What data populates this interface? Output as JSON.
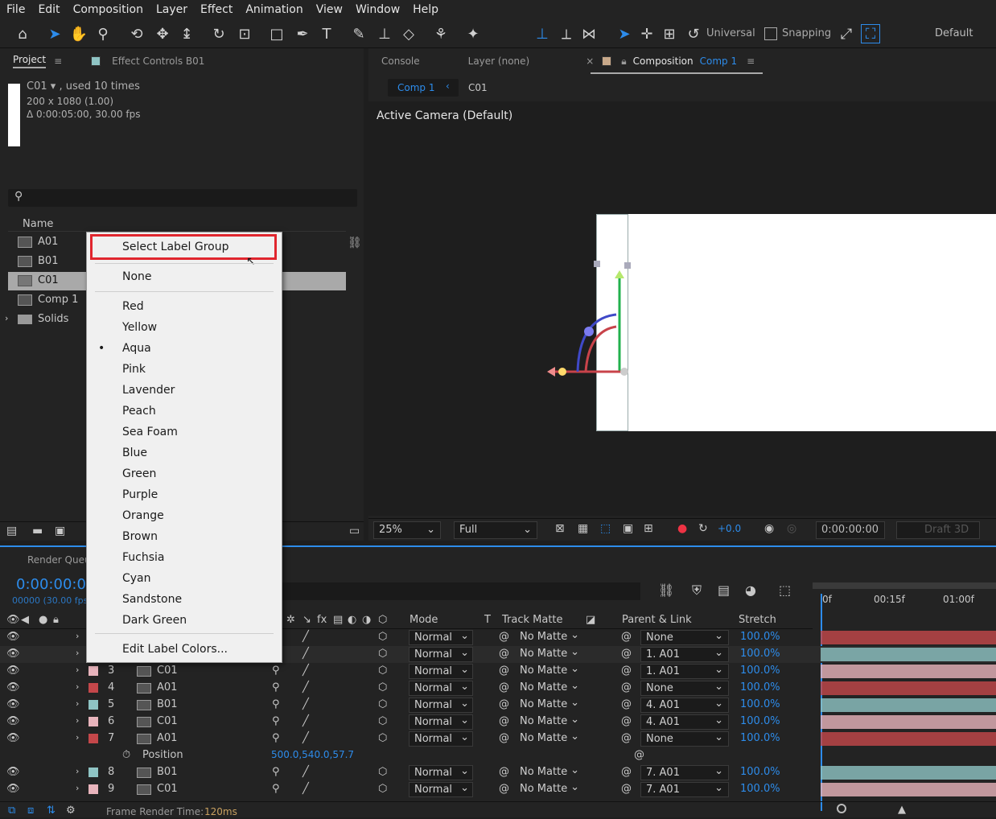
{
  "menu": [
    "File",
    "Edit",
    "Composition",
    "Layer",
    "Effect",
    "Animation",
    "View",
    "Window",
    "Help"
  ],
  "toolbar": {
    "universal_label": "Universal",
    "snapping_label": "Snapping",
    "workspace": "Default"
  },
  "project_panel": {
    "tab_project": "Project",
    "tab_effect_controls": "Effect Controls B01",
    "item_name": "C01",
    "item_used": ", used 10 times",
    "item_dims": "200 x 1080 (1.00)",
    "item_duration": "Δ 0:00:05:00, 30.00 fps",
    "search_placeholder": "",
    "name_header": "Name",
    "items": [
      {
        "name": "A01",
        "type": "footage"
      },
      {
        "name": "B01",
        "type": "footage"
      },
      {
        "name": "C01",
        "type": "footage",
        "selected": true
      },
      {
        "name": "Comp 1",
        "type": "comp"
      },
      {
        "name": "Solids",
        "type": "folder"
      }
    ]
  },
  "comp_panel": {
    "tab_console": "Console",
    "tab_layer": "Layer (none)",
    "tab_composition": "Composition",
    "tab_composition_name": "Comp 1",
    "breadcrumb_comp": "Comp 1",
    "breadcrumb_c01": "C01",
    "camera_label": "Active Camera (Default)",
    "zoom": "25%",
    "resolution": "Full",
    "exposure": "+0.0",
    "timecode": "0:00:00:00",
    "draft3d": "Draft 3D"
  },
  "context_menu": {
    "select_label_group": "Select Label Group",
    "none": "None",
    "colors": [
      "Red",
      "Yellow",
      "Aqua",
      "Pink",
      "Lavender",
      "Peach",
      "Sea Foam",
      "Blue",
      "Green",
      "Purple",
      "Orange",
      "Brown",
      "Fuchsia",
      "Cyan",
      "Sandstone",
      "Dark Green"
    ],
    "checked": "Aqua",
    "edit_label_colors": "Edit Label Colors..."
  },
  "timeline": {
    "tab_render_queue": "Render Queu",
    "timecode": "0:00:00:00",
    "frame_info": "00000 (30.00 fps",
    "headers": {
      "mode": "Mode",
      "t": "T",
      "track_matte": "Track Matte",
      "parent_link": "Parent & Link",
      "stretch": "Stretch"
    },
    "ruler": [
      "0f",
      "00:15f",
      "01:00f"
    ],
    "layers": [
      {
        "num": "",
        "name": "",
        "label": "#c4474a",
        "mode": "Normal",
        "matte": "No Matte",
        "parent": "None",
        "stretch": "100.0%"
      },
      {
        "num": "",
        "name": "",
        "label": "#8fc4c4",
        "mode": "Normal",
        "matte": "No Matte",
        "parent": "1. A01",
        "stretch": "100.0%"
      },
      {
        "num": "3",
        "name": "C01",
        "label": "#e8b4bc",
        "mode": "Normal",
        "matte": "No Matte",
        "parent": "1. A01",
        "stretch": "100.0%"
      },
      {
        "num": "4",
        "name": "A01",
        "label": "#c4474a",
        "mode": "Normal",
        "matte": "No Matte",
        "parent": "None",
        "stretch": "100.0%"
      },
      {
        "num": "5",
        "name": "B01",
        "label": "#8fc4c4",
        "mode": "Normal",
        "matte": "No Matte",
        "parent": "4. A01",
        "stretch": "100.0%"
      },
      {
        "num": "6",
        "name": "C01",
        "label": "#e8b4bc",
        "mode": "Normal",
        "matte": "No Matte",
        "parent": "4. A01",
        "stretch": "100.0%"
      },
      {
        "num": "7",
        "name": "A01",
        "label": "#c4474a",
        "mode": "Normal",
        "matte": "No Matte",
        "parent": "None",
        "stretch": "100.0%"
      },
      {
        "num": "8",
        "name": "B01",
        "label": "#8fc4c4",
        "mode": "Normal",
        "matte": "No Matte",
        "parent": "7. A01",
        "stretch": "100.0%"
      },
      {
        "num": "9",
        "name": "C01",
        "label": "#e8b4bc",
        "mode": "Normal",
        "matte": "No Matte",
        "parent": "7. A01",
        "stretch": "100.0%"
      }
    ],
    "position_label": "Position",
    "position_value": "500.0,540.0,57.7",
    "frame_render_label": "Frame Render Time:",
    "frame_render_value": "120ms"
  },
  "colors": {
    "accent": "#2d8ceb",
    "highlight_box": "#e0262e"
  }
}
